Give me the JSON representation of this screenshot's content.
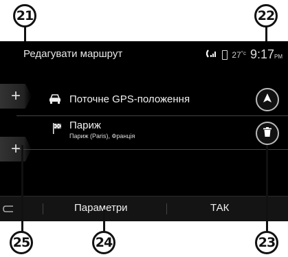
{
  "callouts": {
    "c21": "21",
    "c22": "22",
    "c23": "23",
    "c24": "24",
    "c25": "25"
  },
  "header": {
    "title": "Редагувати маршрут",
    "temperature": "27",
    "temperature_unit": "°c",
    "time": "9:17",
    "time_suffix": "PM"
  },
  "route": [
    {
      "label": "Поточне GPS-положення",
      "icon": "car-icon"
    },
    {
      "label": "Париж",
      "sublabel": "Париж (Paris), Франція",
      "icon": "finish-flag-icon"
    }
  ],
  "buttons": {
    "add_waypoint": "+",
    "navigate_icon": "navigation-arrow-icon",
    "delete_icon": "trash-icon"
  },
  "bottom_bar": {
    "params_label": "Параметри",
    "ok_label": "ТАК"
  }
}
